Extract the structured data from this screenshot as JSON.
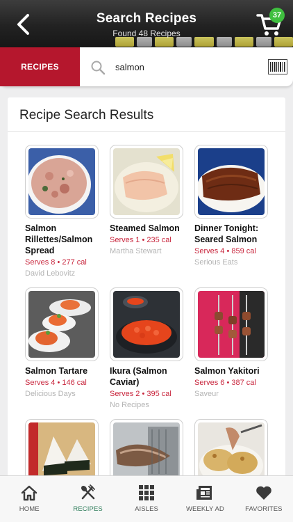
{
  "header": {
    "title": "Search Recipes",
    "subtitle": "Found 48 Recipes",
    "cart_count": "37"
  },
  "search": {
    "scope_label": "RECIPES",
    "query": "salmon"
  },
  "results": {
    "heading": "Recipe Search Results",
    "items": [
      {
        "name": "Salmon Rillettes/Salmon Spread",
        "serves": "Serves 8 • 277 cal",
        "source": "David Lebovitz"
      },
      {
        "name": "Steamed Salmon",
        "serves": "Serves 1 • 235 cal",
        "source": "Martha Stewart"
      },
      {
        "name": "Dinner Tonight: Seared Salmon",
        "serves": "Serves 4 • 859 cal",
        "source": "Serious Eats"
      },
      {
        "name": "Salmon Tartare",
        "serves": "Serves 4 • 146 cal",
        "source": "Delicious Days"
      },
      {
        "name": "Ikura (Salmon Caviar)",
        "serves": "Serves 2 • 395 cal",
        "source": "No Recipes"
      },
      {
        "name": "Salmon Yakitori",
        "serves": "Serves 6 • 387 cal",
        "source": "Saveur"
      },
      {
        "name": "",
        "serves": "",
        "source": ""
      },
      {
        "name": "",
        "serves": "",
        "source": ""
      },
      {
        "name": "",
        "serves": "",
        "source": ""
      }
    ]
  },
  "tabs": [
    {
      "label": "HOME",
      "icon": "home-icon"
    },
    {
      "label": "RECIPES",
      "icon": "fork-knife-icon",
      "active": true
    },
    {
      "label": "AISLES",
      "icon": "grid-icon"
    },
    {
      "label": "WEEKLY AD",
      "icon": "newspaper-icon"
    },
    {
      "label": "FAVORITES",
      "icon": "heart-icon"
    }
  ],
  "colors": {
    "brand_red": "#b5172d",
    "active_tab": "#2f7d5b",
    "badge_green": "#3fbf3f"
  }
}
